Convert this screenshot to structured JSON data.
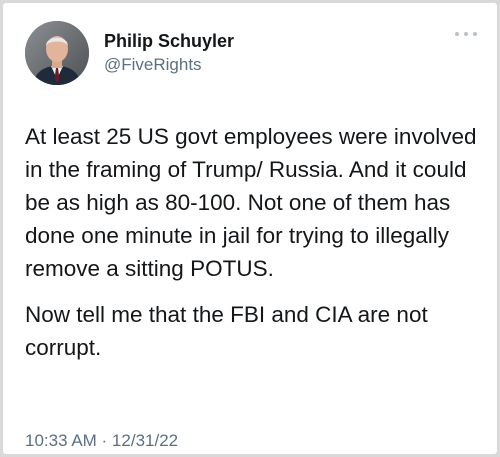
{
  "author": {
    "display_name": "Philip Schuyler",
    "handle": "@FiveRights",
    "avatar_icon": "profile-photo-man-in-suit"
  },
  "menu": {
    "icon": "more-dots-icon"
  },
  "tweet": {
    "paragraph_1": "At least 25 US govt employees were involved in the framing of Trump/ Russia. And it could be as high as 80-100. Not one of them has done one minute in jail for trying to illegally remove a sitting POTUS.",
    "paragraph_2": "Now tell me that the FBI and CIA are not corrupt.",
    "timestamp": "10:33 AM · 12/31/22"
  },
  "colors": {
    "text_primary": "#14171a",
    "text_secondary": "#5b7083",
    "background": "#ffffff"
  }
}
